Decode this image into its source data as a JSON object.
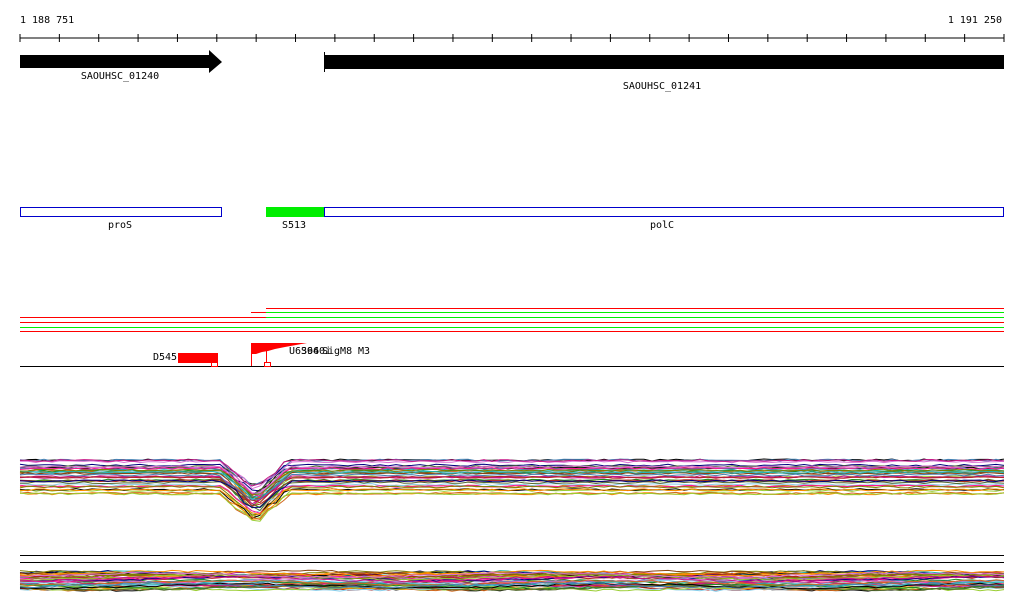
{
  "ruler": {
    "start_label": "1 188 751",
    "end_label": "1 191 250",
    "tick_count": 26
  },
  "genes": [
    {
      "name": "SAOUHSC_01240",
      "strand": "+"
    },
    {
      "name": "SAOUHSC_01241",
      "strand": "+"
    }
  ],
  "features": [
    {
      "name": "proS",
      "color": "#ffffff"
    },
    {
      "name": "S513",
      "color": "#00ee00"
    },
    {
      "name": "polC",
      "color": "#ffffff"
    }
  ],
  "markers": {
    "left_label": "D545",
    "right_labels": [
      "U6396",
      "S640i",
      "SigM8",
      "M3"
    ],
    "color": "#ff0000"
  },
  "colors": {
    "accent_red": "#ff0000",
    "accent_green": "#00ee00",
    "outline_blue": "#0000cc"
  }
}
